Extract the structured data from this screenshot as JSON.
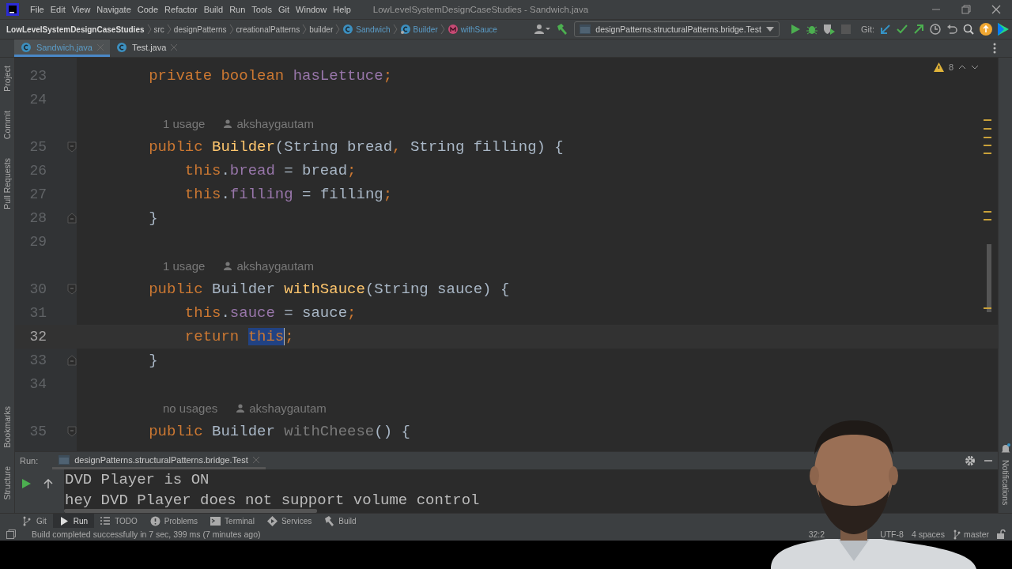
{
  "menu_bar": {
    "items": [
      "File",
      "Edit",
      "View",
      "Navigate",
      "Code",
      "Refactor",
      "Build",
      "Run",
      "Tools",
      "Git",
      "Window",
      "Help"
    ],
    "title": "LowLevelSystemDesignCaseStudies - Sandwich.java"
  },
  "breadcrumbs": [
    {
      "text": "LowLevelSystemDesignCaseStudies",
      "kind": "project"
    },
    {
      "text": "src",
      "kind": "folder"
    },
    {
      "text": "designPatterns",
      "kind": "folder"
    },
    {
      "text": "creationalPatterns",
      "kind": "folder"
    },
    {
      "text": "builder",
      "kind": "folder"
    },
    {
      "text": "Sandwich",
      "kind": "class"
    },
    {
      "text": "Builder",
      "kind": "inner"
    },
    {
      "text": "withSauce",
      "kind": "method"
    }
  ],
  "toolbar": {
    "run_config": "designPatterns.structuralPatterns.bridge.Test",
    "git_label": "Git:"
  },
  "tabs": [
    {
      "label": "Sandwich.java",
      "selected": true
    },
    {
      "label": "Test.java",
      "selected": false
    }
  ],
  "left_tools": [
    {
      "label": "Project",
      "kind": "top"
    },
    {
      "label": "Commit",
      "kind": "top"
    },
    {
      "label": "Pull Requests",
      "kind": "top"
    },
    {
      "label": "Bookmarks",
      "kind": "bottom"
    },
    {
      "label": "Structure",
      "kind": "bottom"
    }
  ],
  "editor": {
    "warnings": "8",
    "lines": [
      {
        "kind": "code",
        "number": "23",
        "current": false,
        "tokens": [
          {
            "kind": "keyword",
            "text": "        private boolean "
          },
          {
            "kind": "field",
            "text": "hasLettuce"
          },
          {
            "kind": "keyword",
            "text": ";"
          }
        ]
      },
      {
        "kind": "code",
        "number": "24",
        "current": false
      },
      {
        "kind": "hint",
        "usage": "1 usage",
        "author": "akshaygautam"
      },
      {
        "kind": "block_start",
        "number": "25",
        "current": false,
        "tokens": [
          {
            "kind": "keyword",
            "text": "        public "
          },
          {
            "kind": "method",
            "text": "Builder"
          },
          {
            "kind": "plain",
            "text": "(String bread"
          },
          {
            "kind": "keyword",
            "text": ", "
          },
          {
            "kind": "plain",
            "text": "String filling) {"
          }
        ]
      },
      {
        "kind": "code",
        "number": "26",
        "current": false,
        "tokens": [
          {
            "kind": "keyword",
            "text": "            this"
          },
          {
            "kind": "plain",
            "text": "."
          },
          {
            "kind": "field",
            "text": "bread"
          },
          {
            "kind": "plain",
            "text": " = bread"
          },
          {
            "kind": "keyword",
            "text": ";"
          }
        ]
      },
      {
        "kind": "code",
        "number": "27",
        "current": false,
        "tokens": [
          {
            "kind": "keyword",
            "text": "            this"
          },
          {
            "kind": "plain",
            "text": "."
          },
          {
            "kind": "field",
            "text": "filling"
          },
          {
            "kind": "plain",
            "text": " = filling"
          },
          {
            "kind": "keyword",
            "text": ";"
          }
        ]
      },
      {
        "kind": "block_end",
        "number": "28",
        "current": false,
        "tokens": [
          {
            "kind": "plain",
            "text": "        }"
          }
        ]
      },
      {
        "kind": "code",
        "number": "29",
        "current": false
      },
      {
        "kind": "hint",
        "usage": "1 usage",
        "author": "akshaygautam"
      },
      {
        "kind": "block_start",
        "number": "30",
        "current": false,
        "tokens": [
          {
            "kind": "keyword",
            "text": "        public "
          },
          {
            "kind": "plain",
            "text": "Builder "
          },
          {
            "kind": "method",
            "text": "withSauce"
          },
          {
            "kind": "plain",
            "text": "(String sauce) {"
          }
        ]
      },
      {
        "kind": "code",
        "number": "31",
        "current": false,
        "tokens": [
          {
            "kind": "keyword",
            "text": "            this"
          },
          {
            "kind": "plain",
            "text": "."
          },
          {
            "kind": "field",
            "text": "sauce"
          },
          {
            "kind": "plain",
            "text": " = sauce"
          },
          {
            "kind": "keyword",
            "text": ";"
          }
        ]
      },
      {
        "kind": "code",
        "number": "32",
        "current": true,
        "tokens": [
          {
            "kind": "keyword",
            "text": "            return "
          },
          {
            "kind": "selection",
            "text": "this"
          },
          {
            "kind": "keyword",
            "text": ";"
          }
        ]
      },
      {
        "kind": "block_end",
        "number": "33",
        "current": false,
        "tokens": [
          {
            "kind": "plain",
            "text": "        }"
          }
        ]
      },
      {
        "kind": "code",
        "number": "34",
        "current": false
      },
      {
        "kind": "hint",
        "usage": "no usages",
        "author": "akshaygautam"
      },
      {
        "kind": "block_start",
        "number": "35",
        "current": false,
        "tokens": [
          {
            "kind": "keyword",
            "text": "        public "
          },
          {
            "kind": "plain",
            "text": "Builder "
          },
          {
            "kind": "unused",
            "text": "withCheese"
          },
          {
            "kind": "plain",
            "text": "() {"
          }
        ]
      }
    ]
  },
  "run_panel": {
    "label": "Run:",
    "tab": "designPatterns.structuralPatterns.bridge.Test",
    "output": [
      "DVD Player is ON",
      "hey DVD Player does not support volume control"
    ]
  },
  "right_tools": [
    {
      "label": "Notifications"
    }
  ],
  "tool_tabs": [
    {
      "label": "Git",
      "selected": false
    },
    {
      "label": "Run",
      "selected": true
    },
    {
      "label": "TODO",
      "selected": false
    },
    {
      "label": "Problems",
      "selected": false
    },
    {
      "label": "Terminal",
      "selected": false
    },
    {
      "label": "Services",
      "selected": false
    },
    {
      "label": "Build",
      "selected": false
    }
  ],
  "status_bar": {
    "message": "Build completed successfully in 7 sec, 399 ms (7 minutes ago)",
    "position": "32:2",
    "encoding": "UTF-8",
    "indent": "4 spaces",
    "branch": "master"
  }
}
